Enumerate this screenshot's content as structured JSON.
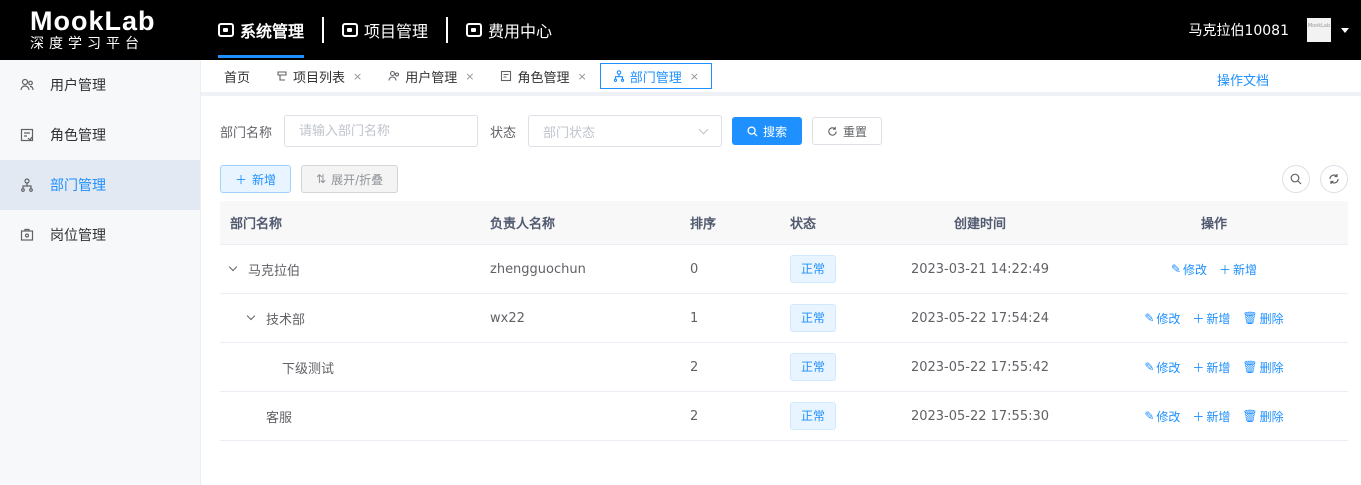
{
  "brand": {
    "name": "MookLab",
    "slogan": "深度学习平台"
  },
  "topnav": [
    {
      "label": "系统管理",
      "active": true,
      "icon": "monitor-icon"
    },
    {
      "label": "项目管理",
      "active": false,
      "icon": "briefcase-icon"
    },
    {
      "label": "费用中心",
      "active": false,
      "icon": "wallet-icon"
    }
  ],
  "user": {
    "name": "马克拉伯10081",
    "avatar_text": "MookLab"
  },
  "sidebar": {
    "items": [
      {
        "label": "用户管理",
        "icon": "users-icon",
        "active": false
      },
      {
        "label": "角色管理",
        "icon": "role-icon",
        "active": false
      },
      {
        "label": "部门管理",
        "icon": "org-icon",
        "active": true
      },
      {
        "label": "岗位管理",
        "icon": "post-icon",
        "active": false
      }
    ]
  },
  "tabs": [
    {
      "label": "首页",
      "closable": false,
      "active": false
    },
    {
      "label": "项目列表",
      "closable": true,
      "active": false
    },
    {
      "label": "用户管理",
      "closable": true,
      "active": false
    },
    {
      "label": "角色管理",
      "closable": true,
      "active": false
    },
    {
      "label": "部门管理",
      "closable": true,
      "active": true
    }
  ],
  "doc_link": "操作文档",
  "filter": {
    "dept_label": "部门名称",
    "dept_placeholder": "请输入部门名称",
    "status_label": "状态",
    "status_placeholder": "部门状态",
    "search_label": "搜索",
    "reset_label": "重置"
  },
  "toolbar": {
    "add_label": "新增",
    "expand_label": "展开/折叠"
  },
  "table": {
    "headers": [
      "部门名称",
      "负责人名称",
      "排序",
      "状态",
      "创建时间",
      "操作"
    ],
    "rows": [
      {
        "name": "马克拉伯",
        "level": 0,
        "expandable": true,
        "leader": "zhengguochun",
        "order": "0",
        "status": "正常",
        "created": "2023-03-21 14:22:49",
        "actions": [
          "修改",
          "新增"
        ]
      },
      {
        "name": "技术部",
        "level": 1,
        "expandable": true,
        "leader": "wx22",
        "order": "1",
        "status": "正常",
        "created": "2023-05-22 17:54:24",
        "actions": [
          "修改",
          "新增",
          "删除"
        ]
      },
      {
        "name": "下级测试",
        "level": 2,
        "expandable": false,
        "leader": "",
        "order": "2",
        "status": "正常",
        "created": "2023-05-22 17:55:42",
        "actions": [
          "修改",
          "新增",
          "删除"
        ]
      },
      {
        "name": "客服",
        "level": 1,
        "expandable": false,
        "leader": "",
        "order": "2",
        "status": "正常",
        "created": "2023-05-22 17:55:30",
        "actions": [
          "修改",
          "新增",
          "删除"
        ]
      }
    ]
  },
  "colors": {
    "primary": "#1e90ff",
    "topbar": "#000000",
    "sidebar_active": "#e3e9f3"
  }
}
